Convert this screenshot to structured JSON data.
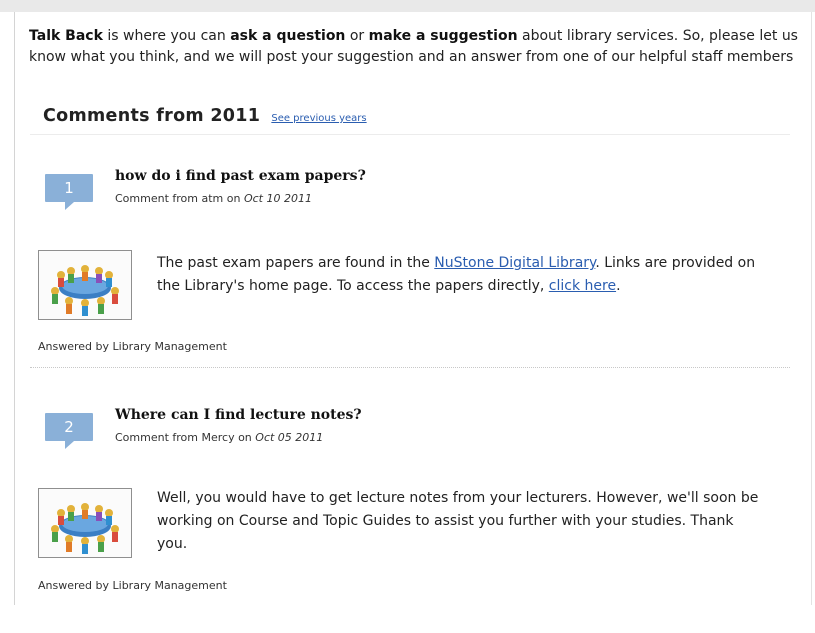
{
  "intro": {
    "p1": "Talk Back",
    "p2": " is where you can ",
    "p3": "ask a question",
    "p4": " or ",
    "p5": "make a suggestion",
    "p6": " about library services. So, please let us know what you think, and we will post your suggestion and an answer from one of our helpful staff members"
  },
  "section": {
    "title": "Comments from 2011",
    "previous_link": "See previous years"
  },
  "comments": [
    {
      "number": "1",
      "question": "how do i find past exam papers?",
      "meta_prefix": "Comment from atm on ",
      "date": "Oct 10 2011",
      "answer_a": "The past exam papers are found in the ",
      "answer_link1": "NuStone Digital Library",
      "answer_b": ".  Links are provided on the Library's home page. To access the papers directly, ",
      "answer_link2": "click here",
      "answer_c": ".",
      "answered_by": "Answered by Library Management"
    },
    {
      "number": "2",
      "question": "Where can I find lecture notes?",
      "meta_prefix": "Comment from Mercy on ",
      "date": "Oct 05 2011",
      "answer_a": " Well, you would have to get lecture notes from your lecturers. However, we'll soon be working on Course and Topic Guides to assist you further with your studies. Thank you.",
      "answered_by": "Answered by Library Management"
    }
  ],
  "colors": {
    "badge": "#8ab0d8",
    "link": "#2a5db0"
  }
}
